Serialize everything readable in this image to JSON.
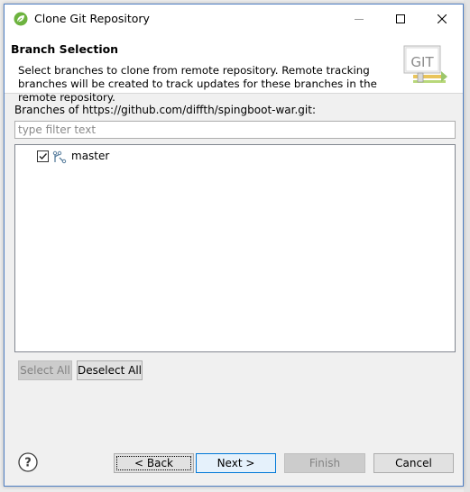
{
  "window": {
    "title": "Clone Git Repository"
  },
  "banner": {
    "title": "Branch Selection",
    "description": "Select branches to clone from remote repository. Remote tracking branches will be created to track updates for these branches in the remote repository.",
    "logo_text": "GIT"
  },
  "branches": {
    "label": "Branches of https://github.com/diffth/spingboot-war.git:",
    "filter_placeholder": "type filter text",
    "filter_value": "",
    "items": [
      {
        "label": "master",
        "checked": true
      }
    ]
  },
  "selection_buttons": {
    "select_all": "Select All",
    "deselect_all": "Deselect All"
  },
  "footer": {
    "back": "< Back",
    "next": "Next >",
    "finish": "Finish",
    "cancel": "Cancel"
  },
  "colors": {
    "accent": "#0078d7",
    "window_border": "#4f7fc4",
    "disabled_text": "#838383"
  }
}
